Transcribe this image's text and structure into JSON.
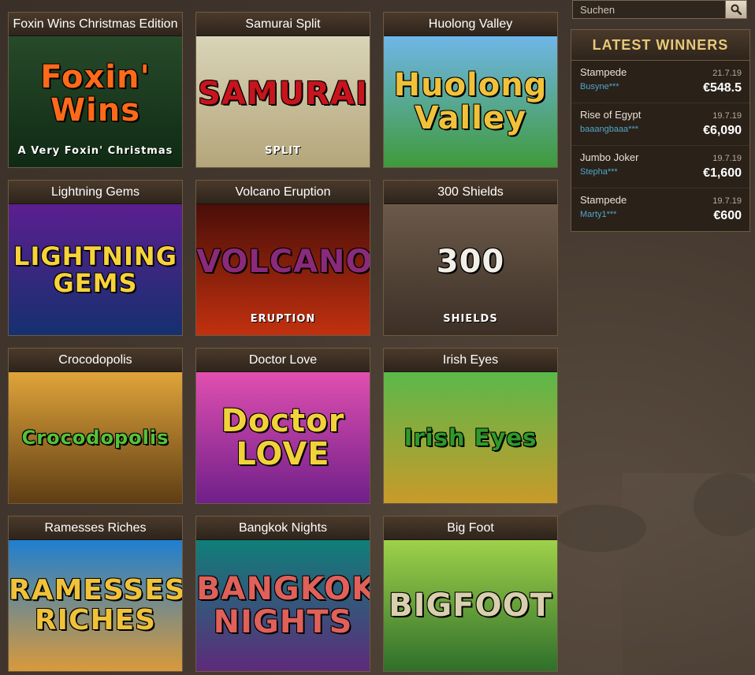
{
  "search": {
    "placeholder": "Suchen"
  },
  "games": [
    {
      "title": "Foxin Wins Christmas Edition",
      "art": "Foxin'\nWins",
      "art_sub": "A Very Foxin' Christmas",
      "colors": [
        "#274a2a",
        "#0f2a14"
      ],
      "text_color": "#ff6a1a"
    },
    {
      "title": "Samurai Split",
      "art": "SAMURAI",
      "art_sub": "SPLIT",
      "colors": [
        "#d9d4b8",
        "#b4a57a"
      ],
      "text_color": "#c8141c"
    },
    {
      "title": "Huolong Valley",
      "art": "Huolong\nValley",
      "art_sub": "",
      "colors": [
        "#6fb6e8",
        "#3f9a3a"
      ],
      "text_color": "#f2c13a"
    },
    {
      "title": "Lightning Gems",
      "art": "LIGHTNING\nGEMS",
      "art_sub": "",
      "colors": [
        "#5b1f8f",
        "#15306f"
      ],
      "text_color": "#f7d23a"
    },
    {
      "title": "Volcano Eruption",
      "art": "VOLCANO",
      "art_sub": "ERUPTION",
      "colors": [
        "#4a0e08",
        "#c2310f"
      ],
      "text_color": "#8a2a7a"
    },
    {
      "title": "300 Shields",
      "art": "300",
      "art_sub": "SHIELDS",
      "colors": [
        "#6b5a4a",
        "#3c2f26"
      ],
      "text_color": "#f2efe8"
    },
    {
      "title": "Crocodopolis",
      "art": "Crocodopolis",
      "art_sub": "",
      "colors": [
        "#e0a43a",
        "#5e3d14"
      ],
      "text_color": "#55c23a"
    },
    {
      "title": "Doctor Love",
      "art": "Doctor\nLOVE",
      "art_sub": "",
      "colors": [
        "#e04fb0",
        "#6f1f8a"
      ],
      "text_color": "#f2d23a"
    },
    {
      "title": "Irish Eyes",
      "art": "Irish Eyes",
      "art_sub": "",
      "colors": [
        "#5bb84a",
        "#c99a2a"
      ],
      "text_color": "#2f9a2a"
    },
    {
      "title": "Ramesses Riches",
      "art": "RAMESSES\nRICHES",
      "art_sub": "",
      "colors": [
        "#1f7fd0",
        "#d99a3a"
      ],
      "text_color": "#f0c23a"
    },
    {
      "title": "Bangkok Nights",
      "art": "BANGKOK\nNIGHTS",
      "art_sub": "",
      "colors": [
        "#0f7f7a",
        "#5e2a7a"
      ],
      "text_color": "#e0605a"
    },
    {
      "title": "Big Foot",
      "art": "BIGFOOT",
      "art_sub": "",
      "colors": [
        "#9fd14a",
        "#2e6f2a"
      ],
      "text_color": "#d9cfae"
    }
  ],
  "winners": {
    "title": "LATEST WINNERS",
    "items": [
      {
        "game": "Stampede",
        "date": "21.7.19",
        "user": "Busyne***",
        "amount": "€548.5"
      },
      {
        "game": "Rise of Egypt",
        "date": "19.7.19",
        "user": "baaangbaaa***",
        "amount": "€6,090"
      },
      {
        "game": "Jumbo Joker",
        "date": "19.7.19",
        "user": "Stepha***",
        "amount": "€1,600"
      },
      {
        "game": "Stampede",
        "date": "19.7.19",
        "user": "Marty1***",
        "amount": "€600"
      }
    ]
  }
}
